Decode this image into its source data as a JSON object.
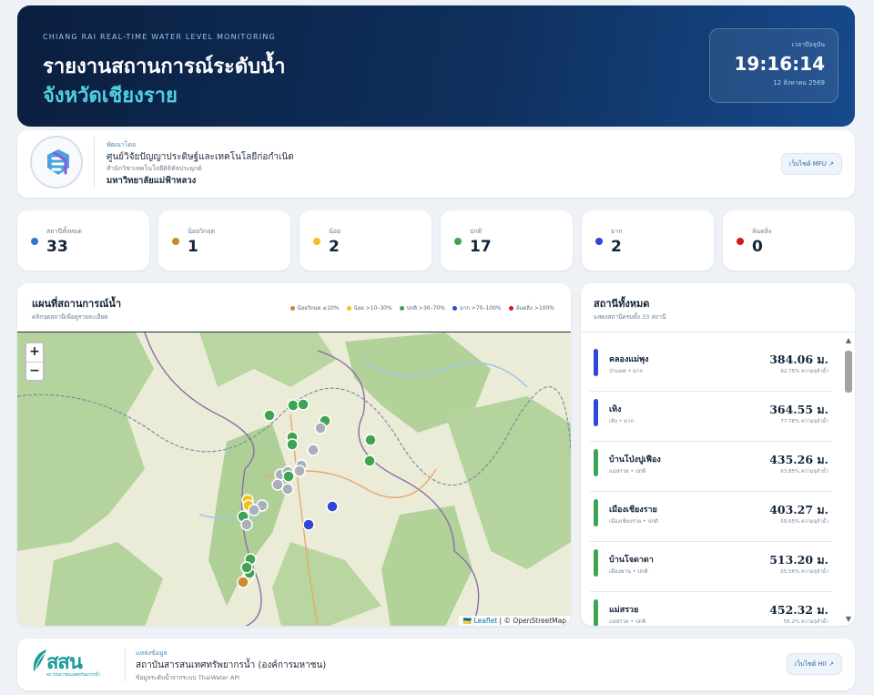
{
  "hero": {
    "eyebrow": "CHIANG RAI REAL-TIME WATER LEVEL MONITORING",
    "title": "รายงานสถานการณ์ระดับน้ำ",
    "subtitle": "จังหวัดเชียงราย",
    "clock_label": "เวลาปัจจุบัน",
    "time": "19:16:14",
    "date": "12 สิงหาคม 2569"
  },
  "org": {
    "label": "พัฒนาโดย",
    "name": "ศูนย์วิจัยปัญญาประดิษฐ์และเทคโนโลยีก่อกำเนิด",
    "sub": "สำนักวิชาเทคโนโลยีดิจิทัลประยุกต์",
    "university": "มหาวิทยาลัยแม่ฟ้าหลวง",
    "button": "เว็บไซต์ MFU ↗"
  },
  "stats": [
    {
      "label": "สถานีทั้งหมด",
      "value": "33",
      "color": "#3b6fd8"
    },
    {
      "label": "น้อยวิกฤต",
      "value": "1",
      "color": "#c98b2b"
    },
    {
      "label": "น้อย",
      "value": "2",
      "color": "#f2c21b"
    },
    {
      "label": "ปกติ",
      "value": "17",
      "color": "#3fa354"
    },
    {
      "label": "มาก",
      "value": "2",
      "color": "#2f47d6"
    },
    {
      "label": "ล้นตลิ่ง",
      "value": "0",
      "color": "#d21a1a"
    }
  ],
  "map_panel": {
    "title": "แผนที่สถานการณ์น้ำ",
    "subtitle": "คลิกจุดสถานีเพื่อดูรายละเอียด",
    "legend": [
      {
        "label": "น้อยวิกฤต ≤10%",
        "color": "#c98b2b"
      },
      {
        "label": "น้อย >10–30%",
        "color": "#f2c21b"
      },
      {
        "label": "ปกติ >30–70%",
        "color": "#3fa354"
      },
      {
        "label": "มาก >70–100%",
        "color": "#2f47d6"
      },
      {
        "label": "ล้นตลิ่ง >100%",
        "color": "#d21a1a"
      }
    ],
    "zoom_in": "+",
    "zoom_out": "−",
    "attribution_leaflet": "🇺🇦 Leaflet",
    "attribution_osm": " | © OpenStreetMap"
  },
  "stations_panel": {
    "title": "สถานีทั้งหมด",
    "subtitle": "แสดงสถานีครบทั้ง 33 สถานี",
    "items": [
      {
        "name": "คลองแม่พุง",
        "meta": "ป่าแดด • มาก",
        "value": "384.06 ม.",
        "pct": "92.75% ความจุลำน้ำ",
        "color": "#2f47d6"
      },
      {
        "name": "เทิง",
        "meta": "เทิง • มาก",
        "value": "364.55 ม.",
        "pct": "77.78% ความจุลำน้ำ",
        "color": "#2f47d6"
      },
      {
        "name": "บ้านโป่งปูเฟือง",
        "meta": "แม่สรวย • ปกติ",
        "value": "435.26 ม.",
        "pct": "63.85% ความจุลำน้ำ",
        "color": "#3fa354"
      },
      {
        "name": "เมืองเชียงราย",
        "meta": "เมืองเชียงราย • ปกติ",
        "value": "403.27 ม.",
        "pct": "59.65% ความจุลำน้ำ",
        "color": "#3fa354"
      },
      {
        "name": "บ้านโจดาดา",
        "meta": "เมืองพาน • ปกติ",
        "value": "513.20 ม.",
        "pct": "55.56% ความจุลำน้ำ",
        "color": "#3fa354"
      },
      {
        "name": "แม่สรวย",
        "meta": "แม่สรวย • ปกติ",
        "value": "452.32 ม.",
        "pct": "55.2% ความจุลำน้ำ",
        "color": "#3fa354"
      }
    ],
    "scroll_up": "▲",
    "scroll_down": "▼"
  },
  "footer": {
    "logo_abbr": "สสน",
    "logo_tag": "สถาบันสารสนเทศทรัพยากรน้ำ",
    "label": "แหล่งข้อมูล",
    "name": "สถาบันสารสนเทศทรัพยากรน้ำ (องค์การมหาชน)",
    "sub": "ข้อมูลระดับน้ำจากระบบ ThaiWater API",
    "button": "เว็บไซต์ HII ↗"
  },
  "map_markers": [
    {
      "color": "#3fa354"
    },
    {
      "color": "#3fa354"
    },
    {
      "color": "#3fa354"
    },
    {
      "color": "#3fa354"
    },
    {
      "color": "#a9b0ba"
    },
    {
      "color": "#3fa354"
    },
    {
      "color": "#a9b0ba"
    },
    {
      "color": "#3fa354"
    },
    {
      "color": "#a9b0ba"
    },
    {
      "color": "#3fa354"
    },
    {
      "color": "#3fa354"
    },
    {
      "color": "#a9b0ba"
    },
    {
      "color": "#a9b0ba"
    },
    {
      "color": "#3fa354"
    },
    {
      "color": "#a9b0ba"
    },
    {
      "color": "#a9b0ba"
    },
    {
      "color": "#a9b0ba"
    },
    {
      "color": "#f2c21b"
    },
    {
      "color": "#f2c21b"
    },
    {
      "color": "#a9b0ba"
    },
    {
      "color": "#a9b0ba"
    },
    {
      "color": "#3fa354"
    },
    {
      "color": "#a9b0ba"
    },
    {
      "color": "#2f47d6"
    },
    {
      "color": "#2f47d6"
    },
    {
      "color": "#3fa354"
    },
    {
      "color": "#f2c21b"
    },
    {
      "color": "#c98b2b"
    },
    {
      "color": "#3fa354"
    },
    {
      "color": "#3fa354"
    }
  ]
}
